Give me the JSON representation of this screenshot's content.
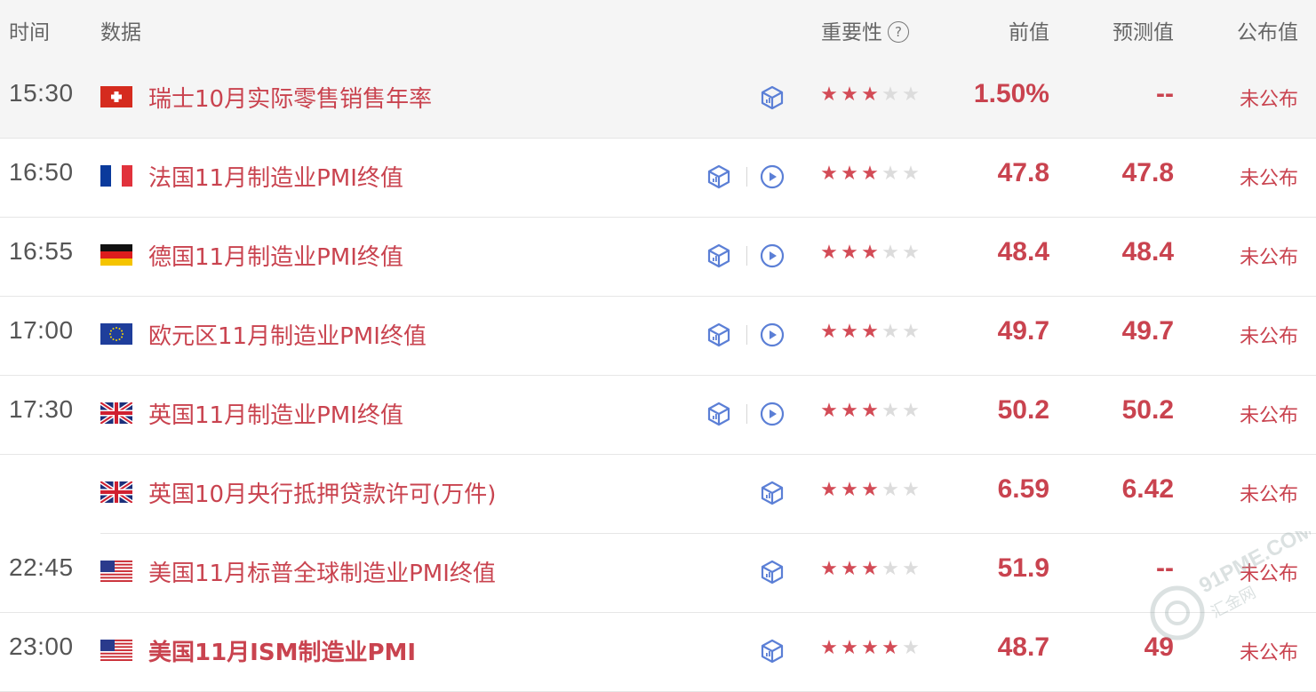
{
  "header": {
    "time": "时间",
    "data": "数据",
    "importance": "重要性",
    "help_icon": "?",
    "previous": "前值",
    "forecast": "预测值",
    "actual": "公布值"
  },
  "rows": [
    {
      "time": "15:30",
      "flag": "switzerland-flag",
      "name": "瑞士10月实际零售销售年率",
      "stars": 3,
      "previous": "1.50%",
      "forecast": "--",
      "actual": "未公布",
      "has_video": false
    },
    {
      "time": "16:50",
      "flag": "france-flag",
      "name": "法国11月制造业PMI终值",
      "stars": 3,
      "previous": "47.8",
      "forecast": "47.8",
      "actual": "未公布",
      "has_video": true
    },
    {
      "time": "16:55",
      "flag": "germany-flag",
      "name": "德国11月制造业PMI终值",
      "stars": 3,
      "previous": "48.4",
      "forecast": "48.4",
      "actual": "未公布",
      "has_video": true
    },
    {
      "time": "17:00",
      "flag": "eu-flag",
      "name": "欧元区11月制造业PMI终值",
      "stars": 3,
      "previous": "49.7",
      "forecast": "49.7",
      "actual": "未公布",
      "has_video": true
    },
    {
      "time": "17:30",
      "flag": "uk-flag",
      "name": "英国11月制造业PMI终值",
      "stars": 3,
      "previous": "50.2",
      "forecast": "50.2",
      "actual": "未公布",
      "has_video": true
    },
    {
      "time": "",
      "flag": "uk-flag",
      "name": "英国10月央行抵押贷款许可(万件)",
      "stars": 3,
      "previous": "6.59",
      "forecast": "6.42",
      "actual": "未公布",
      "has_video": false
    },
    {
      "time": "22:45",
      "flag": "usa-flag",
      "name": "美国11月标普全球制造业PMI终值",
      "stars": 3,
      "previous": "51.9",
      "forecast": "--",
      "actual": "未公布",
      "has_video": false
    },
    {
      "time": "23:00",
      "flag": "usa-flag",
      "name": "美国11月ISM制造业PMI",
      "stars": 4,
      "previous": "48.7",
      "forecast": "49",
      "actual": "未公布",
      "has_video": false,
      "bold": true
    }
  ],
  "watermark": {
    "text": "91PME.COM",
    "subtext": "汇金网"
  },
  "colors": {
    "accent": "#c9434f",
    "star_on": "#d34b56",
    "star_off": "#dcdcdc",
    "icon_blue": "#5b7fd6"
  }
}
